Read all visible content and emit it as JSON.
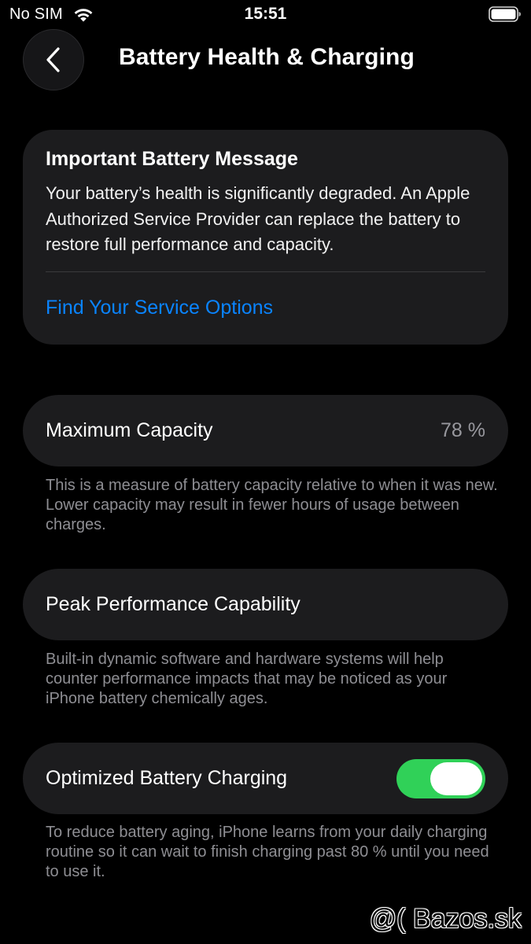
{
  "status_bar": {
    "carrier": "No SIM",
    "time": "15:51",
    "wifi_icon": "wifi-icon",
    "battery_icon": "battery-icon"
  },
  "nav": {
    "back_icon": "chevron-left-icon",
    "title": "Battery Health & Charging"
  },
  "message_card": {
    "title": "Important Battery Message",
    "body": "Your battery’s health is significantly degraded. An Apple Authorized Service Provider can replace the battery to restore full performance and capacity.",
    "link": "Find Your Service Options"
  },
  "maximum_capacity": {
    "label": "Maximum Capacity",
    "value": "78 %",
    "footnote": "This is a measure of battery capacity relative to when it was new. Lower capacity may result in fewer hours of usage between charges."
  },
  "peak_performance": {
    "label": "Peak Performance Capability",
    "footnote": "Built-in dynamic software and hardware systems will help counter performance impacts that may be noticed as your iPhone battery chemically ages."
  },
  "optimized_charging": {
    "label": "Optimized Battery Charging",
    "enabled": true,
    "footnote": "To reduce battery aging, iPhone learns from your daily charging routine so it can wait to finish charging past 80 % until you need to use it."
  },
  "colors": {
    "background": "#000000",
    "card": "#1c1c1e",
    "link": "#0a84ff",
    "toggle_on": "#30d158",
    "secondary_text": "#8e8e93"
  },
  "watermark": "@( Bazos.sk"
}
